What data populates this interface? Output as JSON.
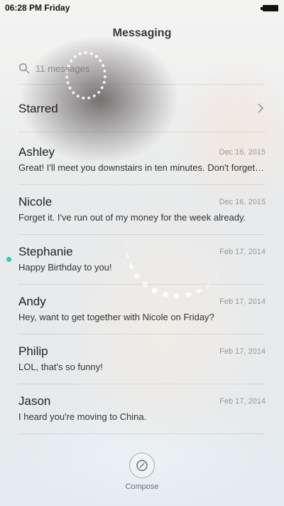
{
  "status_bar": {
    "time": "06:28 PM Friday"
  },
  "header": {
    "title": "Messaging"
  },
  "search": {
    "placeholder": "11 messages"
  },
  "starred": {
    "label": "Starred"
  },
  "conversations": [
    {
      "name": "Ashley",
      "date": "Dec 16, 2015",
      "preview": "Great! I'll meet you downstairs in ten minutes. Don't forget your umbrella.",
      "unread": false
    },
    {
      "name": "Nicole",
      "date": "Dec 16, 2015",
      "preview": "Forget it. I've run out of my money for the week already.",
      "unread": false
    },
    {
      "name": "Stephanie",
      "date": "Feb 17, 2014",
      "preview": "Happy Birthday to you!",
      "unread": true
    },
    {
      "name": "Andy",
      "date": "Feb 17, 2014",
      "preview": "Hey, want to get together with Nicole on Friday?",
      "unread": false
    },
    {
      "name": "Philip",
      "date": "Feb 17, 2014",
      "preview": "LOL, that's so funny!",
      "unread": false
    },
    {
      "name": "Jason",
      "date": "Feb 17, 2014",
      "preview": "I heard you're moving to China.",
      "unread": false
    }
  ],
  "compose": {
    "label": "Compose",
    "icon": "compose-icon"
  },
  "colors": {
    "unread_dot": "#1fd1b6"
  }
}
